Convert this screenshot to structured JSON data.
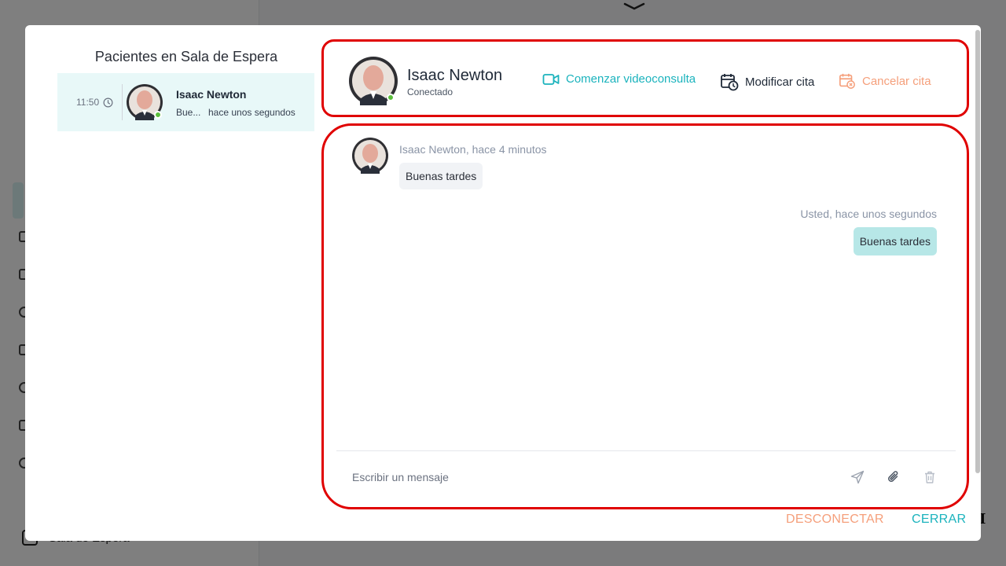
{
  "background": {
    "sidebar_bottom_label": "Sala de Espera"
  },
  "waiting_room": {
    "title": "Pacientes en Sala de Espera",
    "patients": [
      {
        "time": "11:50",
        "name": "Isaac Newton",
        "last_message": "Bue...",
        "last_seen": "hace unos segundos",
        "online": true
      }
    ]
  },
  "header": {
    "patient_name": "Isaac Newton",
    "status": "Conectado",
    "actions": {
      "video": "Comenzar videoconsulta",
      "modify": "Modificar cita",
      "cancel": "Cancelar cita"
    }
  },
  "chat": {
    "messages": [
      {
        "direction": "incoming",
        "meta": "Isaac Newton, hace 4 minutos",
        "text": "Buenas tardes"
      },
      {
        "direction": "outgoing",
        "meta": "Usted, hace unos segundos",
        "text": "Buenas tardes"
      }
    ],
    "input_placeholder": "Escribir un mensaje"
  },
  "footer": {
    "disconnect": "DESCONECTAR",
    "close": "CERRAR"
  },
  "colors": {
    "accent": "#1bb3bd",
    "warning": "#f59f7b",
    "highlight_border": "#e00000",
    "online": "#5bbf3c",
    "selected_row": "#e8f8f8",
    "outgoing_bubble": "#b7e7e7"
  }
}
